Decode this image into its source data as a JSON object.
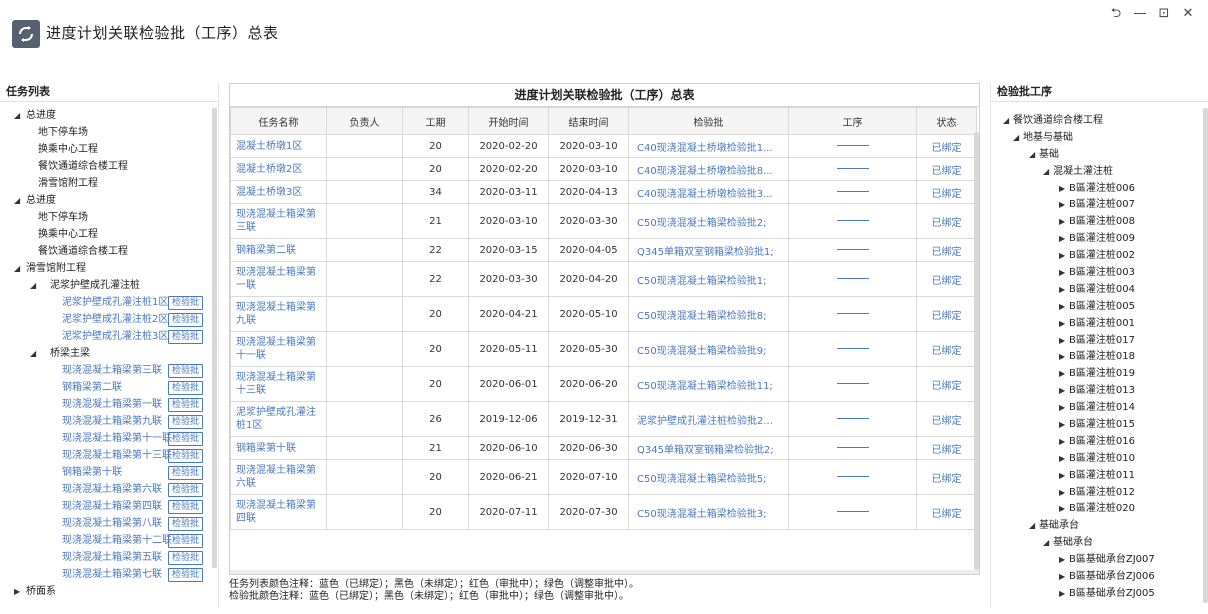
{
  "app": {
    "title": "进度计划关联检验批（工序）总表"
  },
  "window_controls": {
    "restore": "⮌",
    "minimize": "—",
    "maximize": "⊡",
    "close": "✕"
  },
  "left_panel": {
    "title": "任务列表",
    "tree": [
      {
        "label": "总进度",
        "level": 0,
        "arrow": "◢"
      },
      {
        "label": "地下停车场",
        "level": 1
      },
      {
        "label": "换乘中心工程",
        "level": 1
      },
      {
        "label": "餐饮通道综合楼工程",
        "level": 1
      },
      {
        "label": "滑雪馆附工程",
        "level": 1
      },
      {
        "label": "总进度",
        "level": 0,
        "arrow": "◢"
      },
      {
        "label": "地下停车场",
        "level": 1
      },
      {
        "label": "换乘中心工程",
        "level": 1
      },
      {
        "label": "餐饮通道综合楼工程",
        "level": 1
      },
      {
        "label": "滑雪馆附工程",
        "level": 1,
        "arrow": "◢"
      },
      {
        "label": "泥浆护壁成孔灌注桩",
        "level": 2,
        "arrow": "◢"
      },
      {
        "label": "泥浆护壁成孔灌注桩1区",
        "level": 3,
        "blue": true,
        "tag": "检验批"
      },
      {
        "label": "泥浆护壁成孔灌注桩2区",
        "level": 3,
        "blue": true,
        "tag": "检验批"
      },
      {
        "label": "泥浆护壁成孔灌注桩3区",
        "level": 3,
        "blue": true,
        "tag": "检验批"
      },
      {
        "label": "桥梁主梁",
        "level": 2,
        "arrow": "◢"
      },
      {
        "label": "现浇混凝土箱梁第三联",
        "level": 3,
        "blue": true,
        "tag": "检验批"
      },
      {
        "label": "钢箱梁第二联",
        "level": 3,
        "blue": true,
        "tag": "检验批"
      },
      {
        "label": "现浇混凝土箱梁第一联",
        "level": 3,
        "blue": true,
        "tag": "检验批"
      },
      {
        "label": "现浇混凝土箱梁第九联",
        "level": 3,
        "blue": true,
        "tag": "检验批"
      },
      {
        "label": "现浇混凝土箱梁第十一联",
        "level": 3,
        "blue": true,
        "tag": "检验批"
      },
      {
        "label": "现浇混凝土箱梁第十三联",
        "level": 3,
        "blue": true,
        "tag": "检验批"
      },
      {
        "label": "钢箱梁第十联",
        "level": 3,
        "blue": true,
        "tag": "检验批"
      },
      {
        "label": "现浇混凝土箱梁第六联",
        "level": 3,
        "blue": true,
        "tag": "检验批"
      },
      {
        "label": "现浇混凝土箱梁第四联",
        "level": 3,
        "blue": true,
        "tag": "检验批"
      },
      {
        "label": "现浇混凝土箱梁第八联",
        "level": 3,
        "blue": true,
        "tag": "检验批"
      },
      {
        "label": "现浇混凝土箱梁第十二联",
        "level": 3,
        "blue": true,
        "tag": "检验批"
      },
      {
        "label": "现浇混凝土箱梁第五联",
        "level": 3,
        "blue": true,
        "tag": "检验批"
      },
      {
        "label": "现浇混凝土箱梁第七联",
        "level": 3,
        "blue": true,
        "tag": "检验批"
      },
      {
        "label": "桥面系",
        "level": 1,
        "arrow": "▶"
      }
    ]
  },
  "main": {
    "title": "进度计划关联检验批（工序）总表",
    "columns": [
      "任务名称",
      "负责人",
      "工期",
      "开始时间",
      "结束时间",
      "检验批",
      "工序",
      "状态"
    ],
    "rows": [
      {
        "task": "混凝土桥墩1区",
        "owner": "",
        "duration": "20",
        "start": "2020-02-20",
        "end": "2020-03-10",
        "batch": "C40现浇混凝土桥墩检验批1...",
        "status": "已绑定"
      },
      {
        "task": "混凝土桥墩2区",
        "owner": "",
        "duration": "20",
        "start": "2020-02-20",
        "end": "2020-03-10",
        "batch": "C40现浇混凝土桥墩检验批8...",
        "status": "已绑定"
      },
      {
        "task": "混凝土桥墩3区",
        "owner": "",
        "duration": "34",
        "start": "2020-03-11",
        "end": "2020-04-13",
        "batch": "C40现浇混凝土桥墩检验批3...",
        "status": "已绑定"
      },
      {
        "task": "现浇混凝土箱梁第三联",
        "owner": "",
        "duration": "21",
        "start": "2020-03-10",
        "end": "2020-03-30",
        "batch": "C50现浇混凝土箱梁检验批2;",
        "status": "已绑定"
      },
      {
        "task": "钢箱梁第二联",
        "owner": "",
        "duration": "22",
        "start": "2020-03-15",
        "end": "2020-04-05",
        "batch": "Q345单箱双室钢箱梁检验批1;",
        "status": "已绑定"
      },
      {
        "task": "现浇混凝土箱梁第一联",
        "owner": "",
        "duration": "22",
        "start": "2020-03-30",
        "end": "2020-04-20",
        "batch": "C50现浇混凝土箱梁检验批1;",
        "status": "已绑定"
      },
      {
        "task": "现浇混凝土箱梁第九联",
        "owner": "",
        "duration": "20",
        "start": "2020-04-21",
        "end": "2020-05-10",
        "batch": "C50现浇混凝土箱梁检验批8;",
        "status": "已绑定"
      },
      {
        "task": "现浇混凝土箱梁第十一联",
        "owner": "",
        "duration": "20",
        "start": "2020-05-11",
        "end": "2020-05-30",
        "batch": "C50现浇混凝土箱梁检验批9;",
        "status": "已绑定"
      },
      {
        "task": "现浇混凝土箱梁第十三联",
        "owner": "",
        "duration": "20",
        "start": "2020-06-01",
        "end": "2020-06-20",
        "batch": "C50现浇混凝土箱梁检验批11;",
        "status": "已绑定"
      },
      {
        "task": "泥浆护壁成孔灌注桩1区",
        "owner": "",
        "duration": "26",
        "start": "2019-12-06",
        "end": "2019-12-31",
        "batch": "泥浆护壁成孔灌注桩检验批2...",
        "status": "已绑定"
      },
      {
        "task": "钢箱梁第十联",
        "owner": "",
        "duration": "21",
        "start": "2020-06-10",
        "end": "2020-06-30",
        "batch": "Q345单箱双室钢箱梁检验批2;",
        "status": "已绑定"
      },
      {
        "task": "现浇混凝土箱梁第六联",
        "owner": "",
        "duration": "20",
        "start": "2020-06-21",
        "end": "2020-07-10",
        "batch": "C50现浇混凝土箱梁检验批5;",
        "status": "已绑定"
      },
      {
        "task": "现浇混凝土箱梁第四联",
        "owner": "",
        "duration": "20",
        "start": "2020-07-11",
        "end": "2020-07-30",
        "batch": "C50现浇混凝土箱梁检验批3;",
        "status": "已绑定"
      }
    ]
  },
  "notes": {
    "line1": "任务列表颜色注释：蓝色（已绑定）；黑色（未绑定）；红色（审批中）；绿色（调整审批中）。",
    "line2": "检验批颜色注释：蓝色（已绑定）；黑色（未绑定）；红色（审批中）；绿色（调整审批中）。"
  },
  "right_panel": {
    "title": "检验批工序",
    "tree": [
      {
        "label": "餐饮通道综合楼工程",
        "level": 0,
        "arrow": "◢"
      },
      {
        "label": "地基与基础",
        "level": 1,
        "arrow": "◢"
      },
      {
        "label": "基础",
        "level": 2,
        "arrow": "◢"
      },
      {
        "label": "混凝土灌注桩",
        "level": 3,
        "arrow": "◢"
      },
      {
        "label": "B區灌注桩006",
        "level": 4,
        "arrow": "▶"
      },
      {
        "label": "B區灌注桩007",
        "level": 4,
        "arrow": "▶"
      },
      {
        "label": "B區灌注桩008",
        "level": 4,
        "arrow": "▶"
      },
      {
        "label": "B區灌注桩009",
        "level": 4,
        "arrow": "▶"
      },
      {
        "label": "B區灌注桩002",
        "level": 4,
        "arrow": "▶"
      },
      {
        "label": "B區灌注桩003",
        "level": 4,
        "arrow": "▶"
      },
      {
        "label": "B區灌注桩004",
        "level": 4,
        "arrow": "▶"
      },
      {
        "label": "B區灌注桩005",
        "level": 4,
        "arrow": "▶"
      },
      {
        "label": "B區灌注桩001",
        "level": 4,
        "arrow": "▶"
      },
      {
        "label": "B區灌注桩017",
        "level": 4,
        "arrow": "▶"
      },
      {
        "label": "B區灌注桩018",
        "level": 4,
        "arrow": "▶"
      },
      {
        "label": "B區灌注桩019",
        "level": 4,
        "arrow": "▶"
      },
      {
        "label": "B區灌注桩013",
        "level": 4,
        "arrow": "▶"
      },
      {
        "label": "B區灌注桩014",
        "level": 4,
        "arrow": "▶"
      },
      {
        "label": "B區灌注桩015",
        "level": 4,
        "arrow": "▶"
      },
      {
        "label": "B區灌注桩016",
        "level": 4,
        "arrow": "▶"
      },
      {
        "label": "B區灌注桩010",
        "level": 4,
        "arrow": "▶"
      },
      {
        "label": "B區灌注桩011",
        "level": 4,
        "arrow": "▶"
      },
      {
        "label": "B區灌注桩012",
        "level": 4,
        "arrow": "▶"
      },
      {
        "label": "B區灌注桩020",
        "level": 4,
        "arrow": "▶"
      },
      {
        "label": "基础承台",
        "level": 2,
        "arrow": "◢"
      },
      {
        "label": "基础承台",
        "level": 3,
        "arrow": "◢"
      },
      {
        "label": "B區基础承台ZJ007",
        "level": 4,
        "arrow": "▶"
      },
      {
        "label": "B區基础承台ZJ006",
        "level": 4,
        "arrow": "▶"
      },
      {
        "label": "B區基础承台ZJ005",
        "level": 4,
        "arrow": "▶"
      }
    ]
  },
  "colors": {
    "link_blue": "#4a78c2",
    "header_bg": "#f4f4f4",
    "border": "#d9d9d9"
  }
}
